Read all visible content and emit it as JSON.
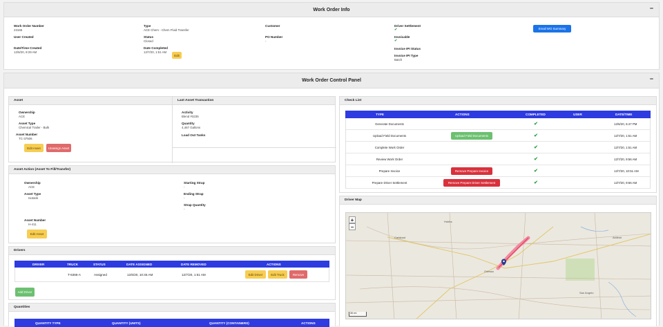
{
  "info": {
    "title": "Work Order Info",
    "collapse": "−",
    "wo_number_label": "Work Order Number",
    "wo_number": "23165",
    "type_label": "Type",
    "type": "ACE Chem - Chem Fluid Transfer",
    "customer_label": "Customer",
    "driver_settlement_label": "Driver Settlement",
    "user_created_label": "User Created",
    "status_label": "Status",
    "status": "Closed",
    "po_label": "PO Number",
    "po": "-",
    "invoiceable_label": "Invoicable",
    "date_created_label": "Date/Time Created",
    "date_created": "12/6/20, 8:29 AM",
    "date_completed_label": "Date Completed",
    "date_completed": "12/7/20, 1:51 AM",
    "edit_label": "Edit",
    "invoice_status_label": "Invoice IPI Status",
    "invoice_type_label": "Invoice IPI Type",
    "invoice_type": "Batch",
    "email_button": "Email WO Summary"
  },
  "panel": {
    "title": "Work Order Control Panel",
    "collapse": "−"
  },
  "asset": {
    "header": "Asset",
    "ownership_label": "Ownership",
    "ownership": "ACE",
    "asset_type_label": "Asset Type",
    "asset_type": "Chemical Trailer - Bulk",
    "asset_number_label": "Asset Number",
    "asset_number": "TC-37506",
    "edit_button": "Edit Asset",
    "unassign_button": "Unassign Asset"
  },
  "last_tx": {
    "header": "Last Asset Transaction",
    "activity_label": "Activity",
    "activity": "Blend #3235",
    "quantity_label": "Quantity",
    "quantity": "4,467 Gallons",
    "loaded_label": "Load Out Tanks"
  },
  "asset_action": {
    "header": "Asset Action (Asset To Fill/Transfer)",
    "ownership_label": "Ownership",
    "ownership": "ACE",
    "asset_type_label": "Asset Type",
    "asset_type": "Isotank",
    "asset_number_label": "Asset Number",
    "asset_number": "H-411",
    "edit_button": "Edit Asset",
    "start_strap_label": "Starting Strap",
    "start_strap": "-",
    "end_strap_label": "Ending Strap",
    "end_strap": "-",
    "strap_qty_label": "Strap Quantity",
    "strap_qty": "-"
  },
  "drivers": {
    "header": "Drivers",
    "columns": [
      "DRIVER",
      "TRUCK",
      "STATUS",
      "DATE ASSIGNED",
      "DATE REMOVED",
      "ACTIONS"
    ],
    "row": {
      "driver": "",
      "truck": "T-6366-A",
      "status": "Assigned",
      "assigned": "12/6/20, 10:45 AM",
      "removed": "12/7/20, 1:51 AM"
    },
    "edit_driver": "Edit Driver",
    "edit_truck": "Edit Truck",
    "remove": "Remove",
    "add_driver": "Add Driver"
  },
  "quantities": {
    "header": "Quantities",
    "columns": [
      "QUANTITY TYPE",
      "QUANTITY (UNITS)",
      "QUANTITY (CONTAINERS)",
      "ACTIONS"
    ]
  },
  "checklist": {
    "header": "Check List",
    "columns": [
      "TYPE",
      "ACTIONS",
      "COMPLETED",
      "USER",
      "DATE/TIME"
    ],
    "rows": [
      {
        "type": "Generate Documents",
        "action": "",
        "user": "",
        "datetime": "12/6/20, 6:47 PM"
      },
      {
        "type": "Upload Field Documents",
        "action": "Upload Field Documents",
        "user": "",
        "datetime": "12/7/20, 1:51 AM"
      },
      {
        "type": "Complete Work Order",
        "action": "",
        "user": "",
        "datetime": "12/7/20, 1:51 AM"
      },
      {
        "type": "Review Work Order",
        "action": "",
        "user": "",
        "datetime": "12/7/20, 9:56 AM"
      },
      {
        "type": "Prepare Invoice",
        "action": "Remove Prepare Invoice",
        "user": "",
        "datetime": "12/7/20, 10:51 AM"
      },
      {
        "type": "Prepare Driver Settlement",
        "action": "Remove Prepare Driver Settlement",
        "user": "",
        "datetime": "12/7/20, 9:56 AM"
      }
    ],
    "check_glyph": "✔"
  },
  "map": {
    "header": "Driver Map",
    "zoom_in": "+",
    "zoom_out": "−",
    "scale": "30 mi",
    "labels": [
      "Hobbs",
      "Carlsbad",
      "Odessa",
      "San Angelo",
      "Abilene"
    ]
  },
  "colors": {
    "accent_blue": "#2d3be0",
    "check_green": "#2ea043"
  }
}
